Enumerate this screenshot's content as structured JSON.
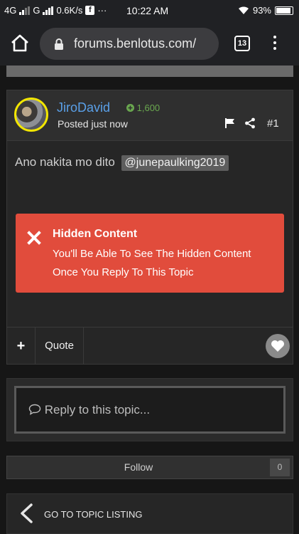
{
  "status_bar": {
    "network1": "4G",
    "network2": "G",
    "speed": "0.6K/s",
    "fb_glyph": "f",
    "more": "···",
    "time": "10:22 AM",
    "battery": "93%"
  },
  "browser": {
    "url": "forums.benlotus.com/",
    "tab_count": "13"
  },
  "post": {
    "author": "JiroDavid",
    "reputation": "1,600",
    "posted": "Posted just now",
    "number": "#1",
    "body": "Ano nakita mo dito",
    "mention": "@junepaulking2019",
    "hidden": {
      "title": "Hidden Content",
      "message": "You'll Be Able To See The Hidden Content Once You Reply To This Topic"
    },
    "actions": {
      "plus": "+",
      "quote": "Quote"
    }
  },
  "reply": {
    "placeholder": "Reply to this topic..."
  },
  "follow": {
    "label": "Follow",
    "count": "0"
  },
  "topic_listing": {
    "label": "GO TO TOPIC LISTING"
  },
  "colors": {
    "author": "#5aa0e8",
    "reputation": "#6aa84f",
    "hidden_box": "#e14c3c",
    "avatar_ring": "#f2e600"
  },
  "icons": [
    "home-icon",
    "lock-icon",
    "tabs-icon",
    "menu-icon",
    "flag-icon",
    "share-icon",
    "close-x-icon",
    "heart-icon",
    "comment-icon",
    "chevron-left-icon"
  ]
}
